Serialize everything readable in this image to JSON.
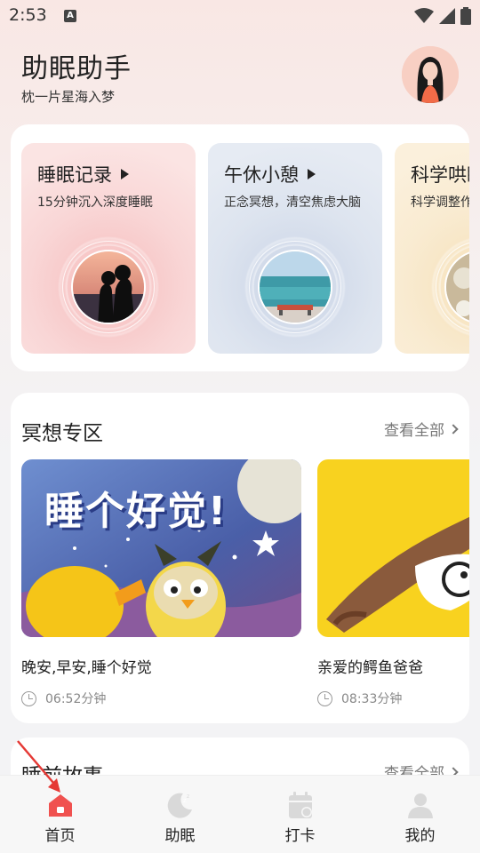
{
  "status_bar": {
    "time": "2:53",
    "notification_icon": "A"
  },
  "header": {
    "title": "助眠助手",
    "subtitle": "枕一片星海入梦"
  },
  "feature_cards": [
    {
      "title": "睡眠记录",
      "desc": "15分钟沉入深度睡眠",
      "bg": "#fbe0df"
    },
    {
      "title": "午休小憩",
      "desc": "正念冥想，清空焦虑大脑",
      "bg": "#e6ebf3"
    },
    {
      "title": "科学哄睡",
      "desc": "科学调整作息",
      "bg": "#fbf0dc"
    }
  ],
  "meditation": {
    "title": "冥想专区",
    "see_all": "查看全部",
    "cards": [
      {
        "title": "晚安,早安,睡个好觉",
        "duration": "06:52分钟",
        "cover_text": "睡个好觉!"
      },
      {
        "title": "亲爱的鳄鱼爸爸",
        "duration": "08:33分钟"
      }
    ]
  },
  "stories": {
    "title": "睡前故事",
    "see_all": "查看全部"
  },
  "bottom_nav": {
    "items": [
      {
        "label": "首页",
        "icon": "home-icon",
        "active": true
      },
      {
        "label": "助眠",
        "icon": "moon-icon"
      },
      {
        "label": "打卡",
        "icon": "calendar-icon"
      },
      {
        "label": "我的",
        "icon": "user-icon"
      }
    ]
  },
  "colors": {
    "accent": "#f0514f",
    "inactive_icon": "#d9d9d9"
  }
}
